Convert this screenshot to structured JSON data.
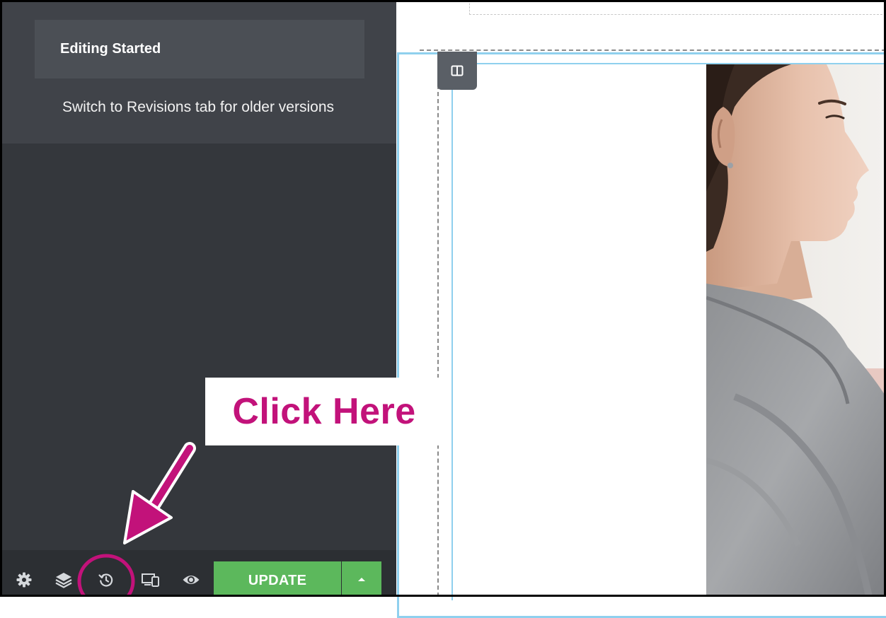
{
  "history_panel": {
    "current_item": "Editing Started",
    "hint": "Switch to Revisions tab for older versions"
  },
  "footer": {
    "tools": [
      {
        "name": "settings",
        "icon": "gear-icon"
      },
      {
        "name": "navigator",
        "icon": "layers-icon"
      },
      {
        "name": "history",
        "icon": "history-icon"
      },
      {
        "name": "responsive-mode",
        "icon": "devices-icon"
      },
      {
        "name": "preview",
        "icon": "eye-icon"
      }
    ],
    "update_label": "UPDATE"
  },
  "annotation": {
    "callout_text": "Click Here",
    "color": "#c2127a"
  },
  "colors": {
    "panel": "#34373c",
    "panel_light": "#404349",
    "update_button": "#5cb85c",
    "element_outline": "#8fd0ee"
  }
}
